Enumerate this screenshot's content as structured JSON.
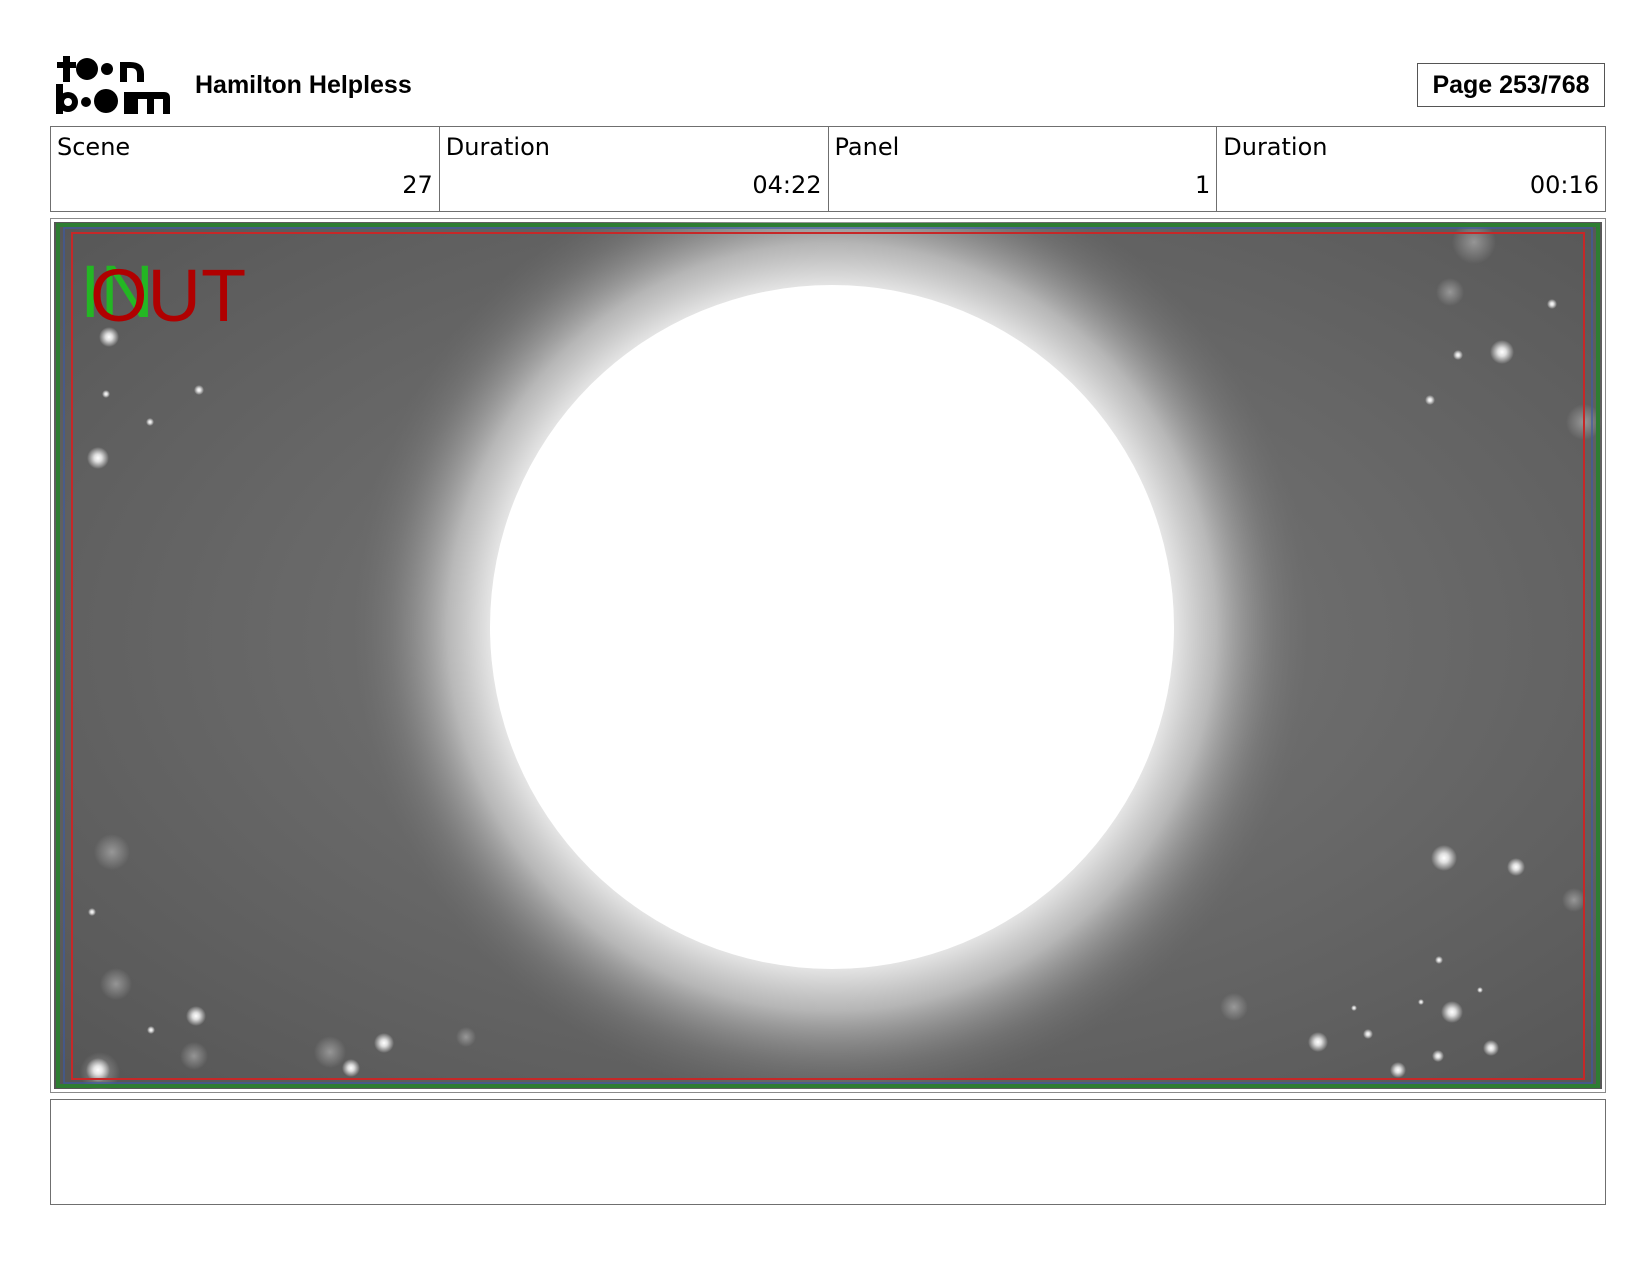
{
  "header": {
    "logo_alt": "toon boom",
    "project_title": "Hamilton Helpless",
    "page_label": "Page 253/768"
  },
  "info": [
    {
      "label": "Scene",
      "value": "27"
    },
    {
      "label": "Duration",
      "value": "04:22"
    },
    {
      "label": "Panel",
      "value": "1"
    },
    {
      "label": "Duration",
      "value": "00:16"
    }
  ],
  "panel": {
    "in_marker": "IN",
    "out_marker": "OUT",
    "in_color": "#1ec21e",
    "out_color": "#b00000",
    "safe_frame_color": "#2e7d32",
    "title_safe_color": "#c62828"
  },
  "notes": {
    "text": ""
  }
}
